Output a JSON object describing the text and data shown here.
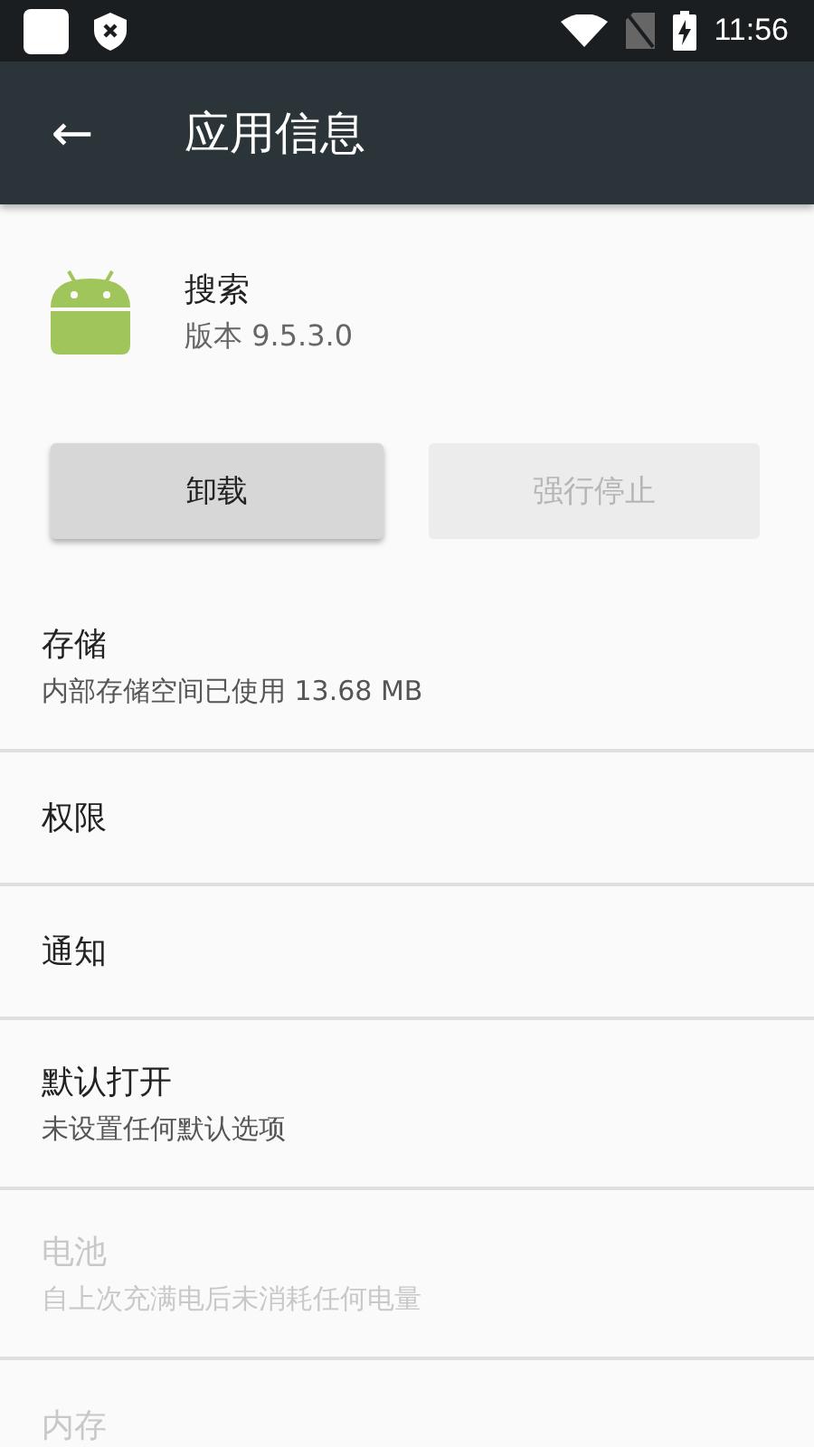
{
  "status_bar": {
    "time": "11:56"
  },
  "toolbar": {
    "back": "←",
    "title": "应用信息"
  },
  "app": {
    "name": "搜索",
    "version": "版本 9.5.3.0"
  },
  "buttons": [
    {
      "label": "卸载",
      "disabled": false
    },
    {
      "label": "强行停止",
      "disabled": true
    }
  ],
  "settings": [
    {
      "title": "存储",
      "subtitle": "内部存储空间已使用 13.68 MB",
      "disabled": false
    },
    {
      "title": "权限",
      "disabled": false
    },
    {
      "title": "通知",
      "disabled": false
    },
    {
      "title": "默认打开",
      "subtitle": "未设置任何默认选项",
      "disabled": false
    },
    {
      "title": "电池",
      "subtitle": "自上次充满电后未消耗任何电量",
      "disabled": true
    },
    {
      "title": "内存",
      "disabled": true
    }
  ]
}
